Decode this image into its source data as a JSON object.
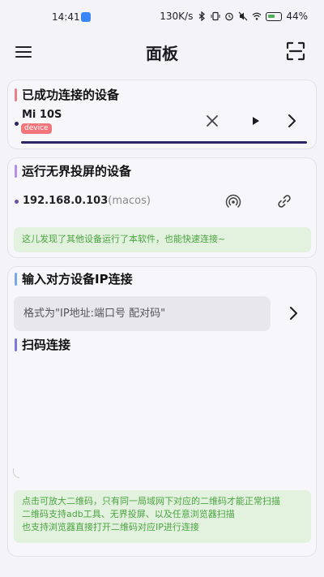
{
  "status_bar": {
    "time": "14:41",
    "network_speed": "130K/s",
    "battery": "44%",
    "icons": [
      "gallery-icon",
      "bluetooth-icon",
      "vibrate-icon",
      "alarm-icon",
      "mute-icon",
      "wifi-icon",
      "battery-icon"
    ]
  },
  "app_bar": {
    "title": "面板",
    "menu_icon": "menu-icon",
    "scan_icon": "scan-icon"
  },
  "connected": {
    "title": "已成功连接的设备",
    "device_name": "Mi 10S",
    "device_badge": "device",
    "actions": [
      "close-icon",
      "play-icon",
      "chevron-right-icon"
    ]
  },
  "running": {
    "title": "运行无界投屏的设备",
    "ip": "192.168.0.103",
    "os": "(macos)",
    "actions": [
      "cast-icon",
      "link-icon"
    ],
    "hint": "这儿发现了其他设备运行了本软件，也能快速连接~"
  },
  "manual": {
    "title": "输入对方设备IP连接",
    "placeholder": "格式为\"IP地址:端口号 配对码\"",
    "value": ""
  },
  "qr": {
    "title": "扫码连接",
    "hint_lines": [
      "点击可放大二维码，只有同一局域网下对应的二维码才能正常扫描",
      "二维码支持adb工具、无界投屏、以及任意浏览器扫描",
      "也支持浏览器直接打开二维码对应IP进行连接"
    ]
  },
  "colors": {
    "accent_connected": "#e8828a",
    "accent_running": "#b78ee6",
    "accent_manual": "#7aa7e8",
    "accent_qr": "#7b78e0",
    "badge": "#f0767c",
    "hint_bg": "#e3f1df",
    "hint_text": "#49a63f",
    "indicator": "#2b2566"
  }
}
